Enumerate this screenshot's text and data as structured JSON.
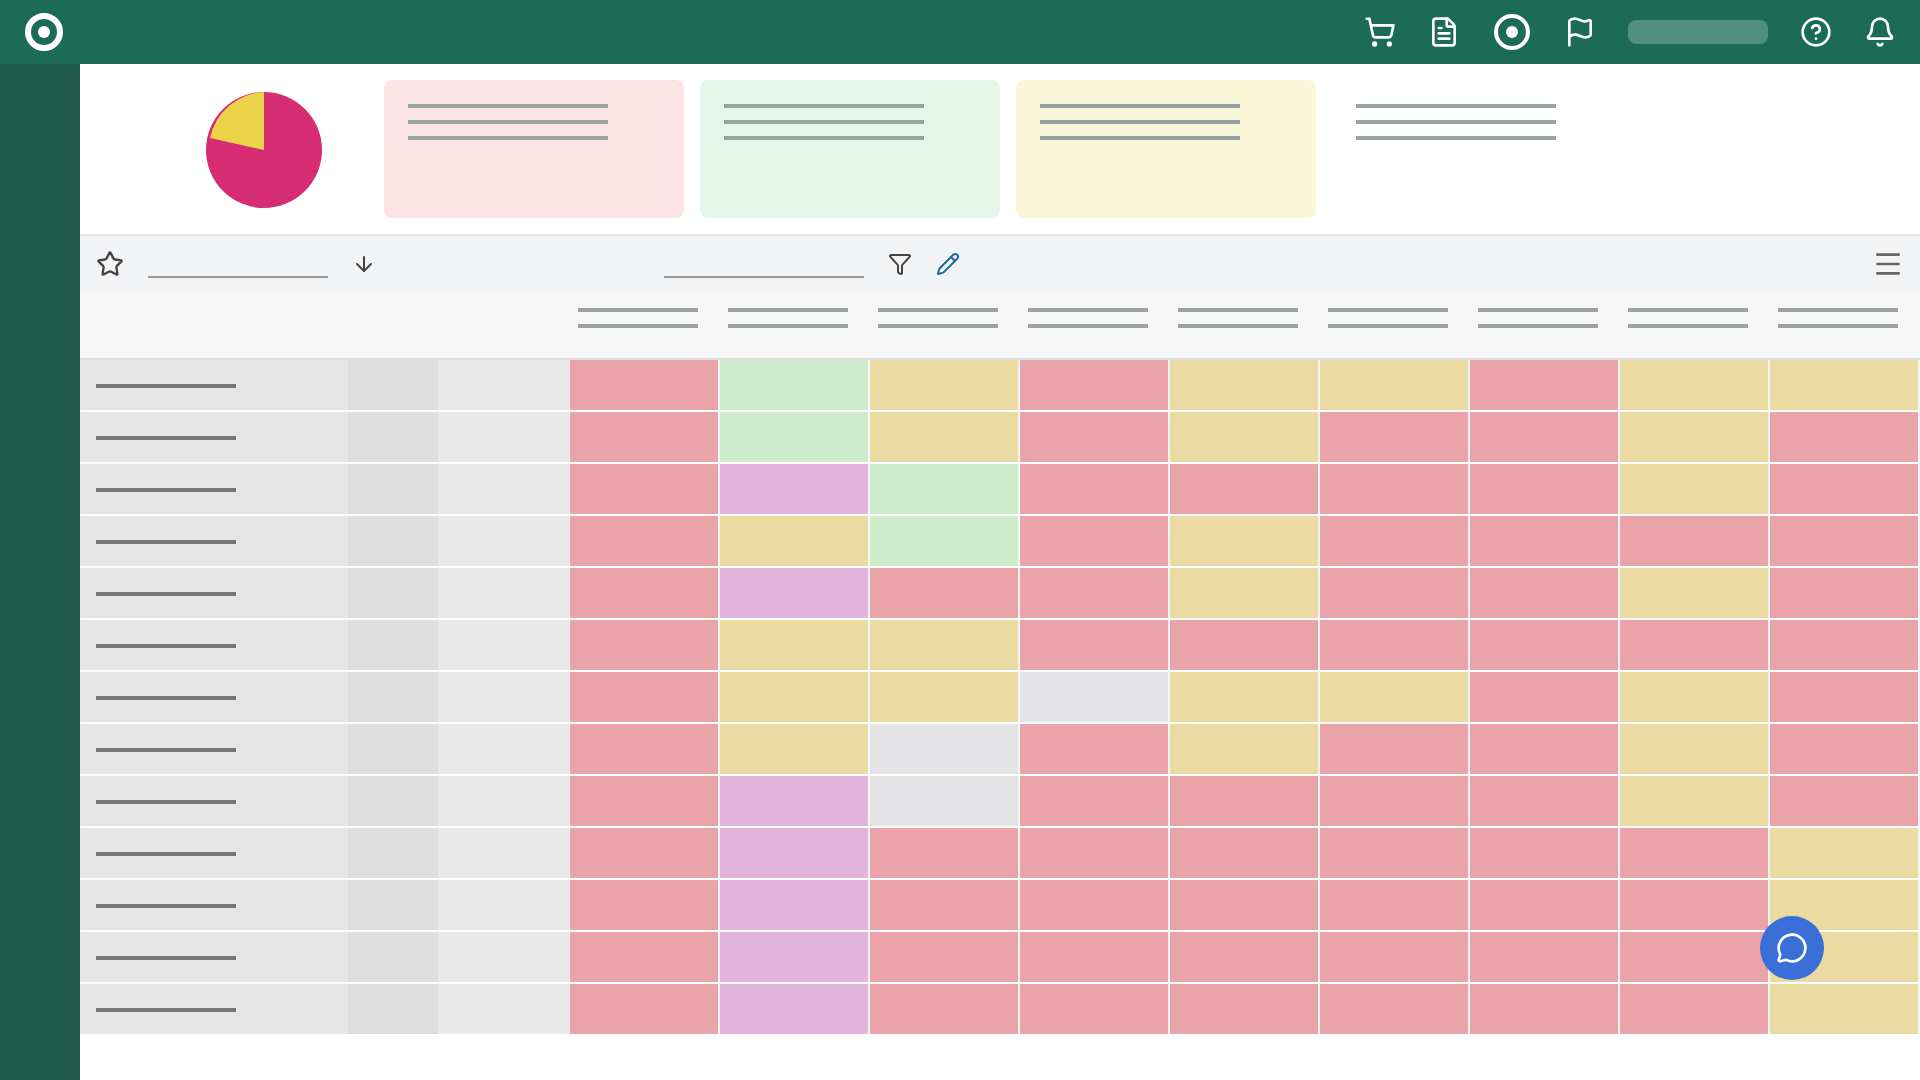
{
  "summary_cards": [
    {
      "color": "#fbe3e6"
    },
    {
      "color": "#e3f6ea"
    },
    {
      "color": "#fbf6d8"
    },
    {
      "color": "#ffffff"
    }
  ],
  "table": {
    "rows": [
      {
        "cells": [
          {
            "color": "#e9a3a9"
          },
          {
            "color": "#cdeccb"
          },
          {
            "color": "#ecdaa3"
          },
          {
            "color": "#e9a3a9"
          },
          {
            "color": "#ecdaa3"
          },
          {
            "color": "#ecdaa3"
          },
          {
            "color": "#e9a3a9"
          },
          {
            "color": "#ecdaa3"
          },
          {
            "color": "#ecdaa3"
          }
        ]
      },
      {
        "cells": [
          {
            "color": "#e9a3a9"
          },
          {
            "color": "#cdeccb"
          },
          {
            "color": "#ecdaa3"
          },
          {
            "color": "#e9a3a9"
          },
          {
            "color": "#ecdaa3"
          },
          {
            "color": "#e9a3a9"
          },
          {
            "color": "#e9a3a9"
          },
          {
            "color": "#ecdaa3"
          },
          {
            "color": "#e9a3a9"
          }
        ]
      },
      {
        "cells": [
          {
            "color": "#e9a3a9"
          },
          {
            "color": "#e2b3dc"
          },
          {
            "color": "#cdeccb"
          },
          {
            "color": "#e9a3a9"
          },
          {
            "color": "#e9a3a9"
          },
          {
            "color": "#e9a3a9"
          },
          {
            "color": "#e9a3a9"
          },
          {
            "color": "#ecdaa3"
          },
          {
            "color": "#e9a3a9"
          }
        ]
      },
      {
        "cells": [
          {
            "color": "#e9a3a9"
          },
          {
            "color": "#ecdaa3"
          },
          {
            "color": "#cdeccb"
          },
          {
            "color": "#e9a3a9"
          },
          {
            "color": "#ecdaa3"
          },
          {
            "color": "#e9a3a9"
          },
          {
            "color": "#e9a3a9"
          },
          {
            "color": "#e9a3a9"
          },
          {
            "color": "#e9a3a9"
          }
        ]
      },
      {
        "cells": [
          {
            "color": "#e9a3a9"
          },
          {
            "color": "#e2b3dc"
          },
          {
            "color": "#e9a3a9"
          },
          {
            "color": "#e9a3a9"
          },
          {
            "color": "#ecdaa3"
          },
          {
            "color": "#e9a3a9"
          },
          {
            "color": "#e9a3a9"
          },
          {
            "color": "#ecdaa3"
          },
          {
            "color": "#e9a3a9"
          }
        ]
      },
      {
        "cells": [
          {
            "color": "#e9a3a9"
          },
          {
            "color": "#ecdaa3"
          },
          {
            "color": "#ecdaa3"
          },
          {
            "color": "#e9a3a9"
          },
          {
            "color": "#e9a3a9"
          },
          {
            "color": "#e9a3a9"
          },
          {
            "color": "#e9a3a9"
          },
          {
            "color": "#e9a3a9"
          },
          {
            "color": "#e9a3a9"
          }
        ]
      },
      {
        "cells": [
          {
            "color": "#e9a3a9"
          },
          {
            "color": "#ecdaa3"
          },
          {
            "color": "#ecdaa3"
          },
          {
            "color": "#e4e4e6"
          },
          {
            "color": "#ecdaa3"
          },
          {
            "color": "#ecdaa3"
          },
          {
            "color": "#e9a3a9"
          },
          {
            "color": "#ecdaa3"
          },
          {
            "color": "#e9a3a9"
          }
        ]
      },
      {
        "cells": [
          {
            "color": "#e9a3a9"
          },
          {
            "color": "#ecdaa3"
          },
          {
            "color": "#e4e4e6"
          },
          {
            "color": "#e9a3a9"
          },
          {
            "color": "#ecdaa3"
          },
          {
            "color": "#e9a3a9"
          },
          {
            "color": "#e9a3a9"
          },
          {
            "color": "#ecdaa3"
          },
          {
            "color": "#e9a3a9"
          }
        ]
      },
      {
        "cells": [
          {
            "color": "#e9a3a9"
          },
          {
            "color": "#e2b3dc"
          },
          {
            "color": "#e4e4e6"
          },
          {
            "color": "#e9a3a9"
          },
          {
            "color": "#e9a3a9"
          },
          {
            "color": "#e9a3a9"
          },
          {
            "color": "#e9a3a9"
          },
          {
            "color": "#ecdaa3"
          },
          {
            "color": "#e9a3a9"
          }
        ]
      },
      {
        "cells": [
          {
            "color": "#e9a3a9"
          },
          {
            "color": "#e2b3dc"
          },
          {
            "color": "#e9a3a9"
          },
          {
            "color": "#e9a3a9"
          },
          {
            "color": "#e9a3a9"
          },
          {
            "color": "#e9a3a9"
          },
          {
            "color": "#e9a3a9"
          },
          {
            "color": "#e9a3a9"
          },
          {
            "color": "#ecdaa3"
          }
        ]
      },
      {
        "cells": [
          {
            "color": "#e9a3a9"
          },
          {
            "color": "#e2b3dc"
          },
          {
            "color": "#e9a3a9"
          },
          {
            "color": "#e9a3a9"
          },
          {
            "color": "#e9a3a9"
          },
          {
            "color": "#e9a3a9"
          },
          {
            "color": "#e9a3a9"
          },
          {
            "color": "#e9a3a9"
          },
          {
            "color": "#ecdaa3"
          }
        ]
      },
      {
        "cells": [
          {
            "color": "#e9a3a9"
          },
          {
            "color": "#e2b3dc"
          },
          {
            "color": "#e9a3a9"
          },
          {
            "color": "#e9a3a9"
          },
          {
            "color": "#e9a3a9"
          },
          {
            "color": "#e9a3a9"
          },
          {
            "color": "#e9a3a9"
          },
          {
            "color": "#e9a3a9"
          },
          {
            "color": "#ecdaa3"
          }
        ]
      },
      {
        "cells": [
          {
            "color": "#e9a3a9"
          },
          {
            "color": "#e2b3dc"
          },
          {
            "color": "#e9a3a9"
          },
          {
            "color": "#e9a3a9"
          },
          {
            "color": "#e9a3a9"
          },
          {
            "color": "#e9a3a9"
          },
          {
            "color": "#e9a3a9"
          },
          {
            "color": "#e9a3a9"
          },
          {
            "color": "#ecdaa3"
          }
        ]
      }
    ]
  }
}
